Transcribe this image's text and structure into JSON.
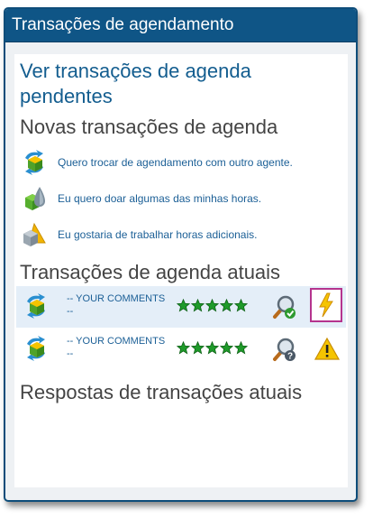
{
  "panel": {
    "title": "Transações de agendamento"
  },
  "pending_link": "Ver transações de agenda pendentes",
  "new_section": {
    "heading": "Novas transações de agenda",
    "actions": [
      {
        "label": "Quero trocar de agendamento com outro agente.",
        "icon": "swap-schedule-icon"
      },
      {
        "label": "Eu quero doar algumas das minhas horas.",
        "icon": "donate-hours-icon"
      },
      {
        "label": "Eu gostaria de trabalhar horas adicionais.",
        "icon": "extra-hours-icon"
      }
    ]
  },
  "current_section": {
    "heading": "Transações de agenda atuais",
    "rows": [
      {
        "comment": "-- YOUR COMMENTS --",
        "rating": 5,
        "detail_icon": "view-details-approved-icon",
        "status_icon": "lightning-icon",
        "highlighted": true
      },
      {
        "comment": "-- YOUR COMMENTS --",
        "rating": 5,
        "detail_icon": "view-details-pending-icon",
        "status_icon": "warning-icon",
        "highlighted": false
      }
    ]
  },
  "responses_section": {
    "heading": "Respostas de transações atuais"
  },
  "colors": {
    "header_bg": "#0f5586",
    "link": "#135d8f",
    "heading_text": "#444444",
    "star": "#1f9a2a",
    "highlight_row": "#e4eef8",
    "focus_border": "#b5348e"
  }
}
